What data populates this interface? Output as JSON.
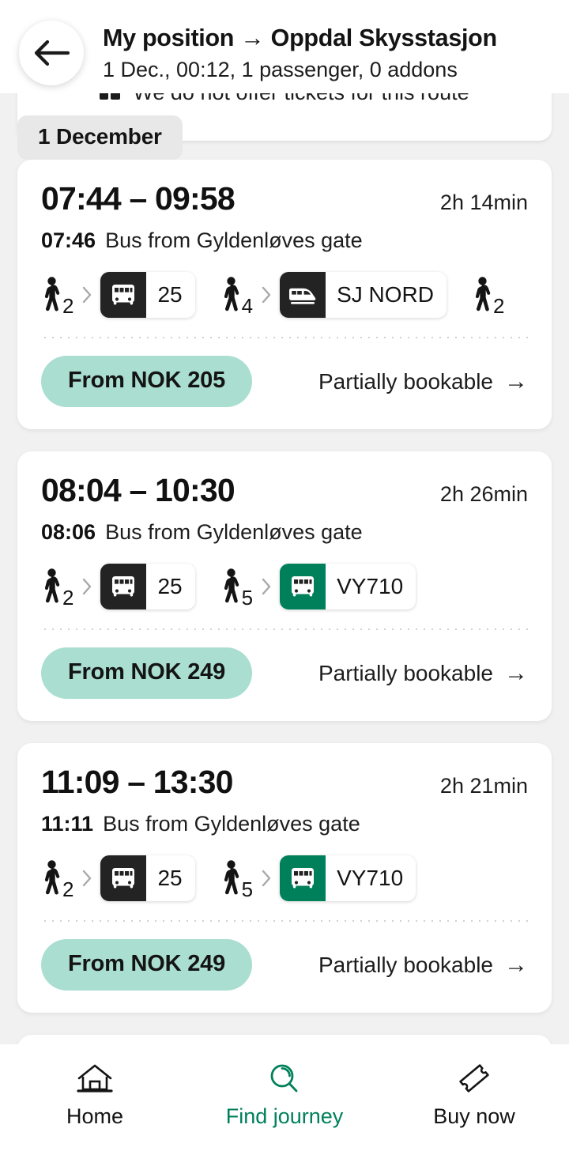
{
  "header": {
    "back_icon": "arrow-left-icon",
    "title": "My position → Oppdal Skysstasjon",
    "subtitle": "1 Dec., 00:12, 1 passenger, 0 addons"
  },
  "notice": {
    "icon": "ticket-icon",
    "text": "We do not offer tickets for this route"
  },
  "date_chip": "1 December",
  "colors": {
    "accent_teal": "#00805a",
    "price_pill": "#a9ded1",
    "mode_dark": "#232323",
    "page_bg": "#f1f1f1",
    "card_bg": "#ffffff"
  },
  "journeys": [
    {
      "times": "07:44 – 09:58",
      "duration": "2h 14min",
      "departure_time": "07:46",
      "departure_desc": "Bus from Gyldenløves gate",
      "legs": [
        {
          "kind": "walk",
          "minutes": "2"
        },
        {
          "kind": "chevron"
        },
        {
          "kind": "transport",
          "mode": "bus",
          "label": "25",
          "color": "#232323"
        },
        {
          "kind": "walk",
          "minutes": "4"
        },
        {
          "kind": "chevron"
        },
        {
          "kind": "transport",
          "mode": "train",
          "label": "SJ NORD",
          "color": "#232323"
        },
        {
          "kind": "walk",
          "minutes": "2"
        }
      ],
      "price": "From NOK 205",
      "bookable": "Partially bookable",
      "bookable_arrow": "→"
    },
    {
      "times": "08:04 – 10:30",
      "duration": "2h 26min",
      "departure_time": "08:06",
      "departure_desc": "Bus from Gyldenløves gate",
      "legs": [
        {
          "kind": "walk",
          "minutes": "2"
        },
        {
          "kind": "chevron"
        },
        {
          "kind": "transport",
          "mode": "bus",
          "label": "25",
          "color": "#232323"
        },
        {
          "kind": "walk",
          "minutes": "5"
        },
        {
          "kind": "chevron"
        },
        {
          "kind": "transport",
          "mode": "bus",
          "label": "VY710",
          "color": "#00805a"
        }
      ],
      "price": "From NOK 249",
      "bookable": "Partially bookable",
      "bookable_arrow": "→"
    },
    {
      "times": "11:09 – 13:30",
      "duration": "2h 21min",
      "departure_time": "11:11",
      "departure_desc": "Bus from Gyldenløves gate",
      "legs": [
        {
          "kind": "walk",
          "minutes": "2"
        },
        {
          "kind": "chevron"
        },
        {
          "kind": "transport",
          "mode": "bus",
          "label": "25",
          "color": "#232323"
        },
        {
          "kind": "walk",
          "minutes": "5"
        },
        {
          "kind": "chevron"
        },
        {
          "kind": "transport",
          "mode": "bus",
          "label": "VY710",
          "color": "#00805a"
        }
      ],
      "price": "From NOK 249",
      "bookable": "Partially bookable",
      "bookable_arrow": "→"
    }
  ],
  "bottom_nav": [
    {
      "label": "Home",
      "icon": "home-icon",
      "active": false
    },
    {
      "label": "Find journey",
      "icon": "search-icon",
      "active": true
    },
    {
      "label": "Buy now",
      "icon": "ticket-icon",
      "active": false
    }
  ]
}
